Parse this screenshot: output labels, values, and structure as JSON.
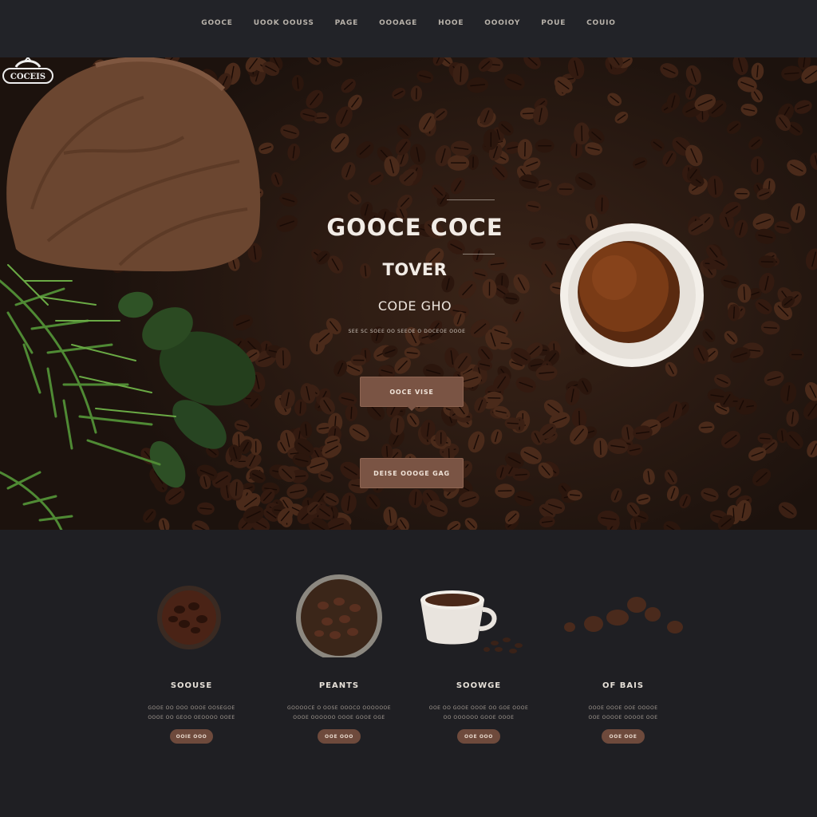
{
  "nav": {
    "items": [
      "GOOCE",
      "UOOK OOUSS",
      "PAGE",
      "OOOAGE",
      "HOOE",
      "OOOIOY",
      "POUE",
      "COUIO"
    ]
  },
  "hero": {
    "badge": "COCEIS",
    "title": "GOOCE COCE",
    "subtitle": "TOVER",
    "tagline": "CODE GHO",
    "small_text": "SEE SC SOEE OO SEEOE O DOCEOE OOOE",
    "button_primary": "OOCE VISE",
    "button_secondary": "DEISE OOOGE GAG"
  },
  "features": [
    {
      "title": "SOOUSE",
      "text_line1": "GOOE OO OOO OOOE OOSEGOE",
      "text_line2": "OOOE OO GEOO OEOOOO OOEE",
      "button": "OOIE OOO"
    },
    {
      "title": "PEANTS",
      "text_line1": "GOOOOCE O OOSE OOOCO OOOOOOE",
      "text_line2": "OOOE OOOOOO OOOE GOOE OGE",
      "button": "OOE OOO"
    },
    {
      "title": "SOOWGE",
      "text_line1": "OOE OO GOOE OOOE OO GOE OOOE",
      "text_line2": "OO OOOOOO GOOE OOOE",
      "button": "OOE OOO"
    },
    {
      "title": "OF BAIS",
      "text_line1": "OOOE OOOE OOE OOOOE",
      "text_line2": "OOE OOOOE OOOOE OOE",
      "button": "OOE OOE"
    }
  ],
  "colors": {
    "background": "#1f1f23",
    "nav": "#222328",
    "accent": "#7a5444",
    "bean": "#3b2418"
  }
}
